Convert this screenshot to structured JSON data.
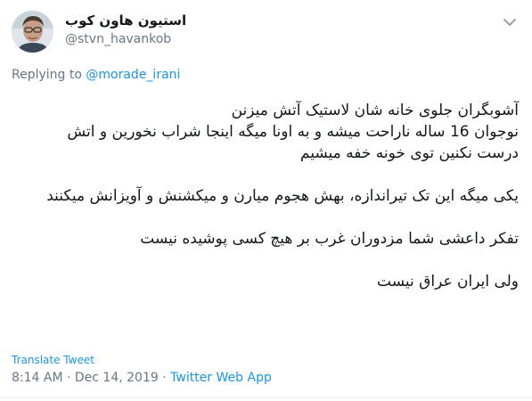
{
  "author": {
    "display_name": "استیون هاون کوب",
    "handle": "@stvn_havankob"
  },
  "reply": {
    "prefix": "Replying to",
    "to_handle": "@morade_irani"
  },
  "tweet": {
    "lines": [
      "آشوبگران جلوی خانه شان لاستیک آتش میزنن",
      "نوجوان 16 ساله ناراحت میشه و به اونا میگه اینجا شراب نخورین و اتش",
      "درست نکنین توی خونه خفه میشیم",
      "یکی میگه این تک تیراندازه، بهش هجوم میارن و میکشنش و آویزانش میکنند",
      "تفکر داعشی شما مزدوران غرب بر هیچ کسی پوشیده نیست",
      "ولی ایران عراق نیست"
    ]
  },
  "translate_label": "Translate Tweet",
  "timestamp": "8:14 AM · Dec 14, 2019",
  "separator": " · ",
  "source": "Twitter Web App",
  "colors": {
    "link": "#1b95e0",
    "muted": "#657786",
    "text": "#14171a"
  },
  "icons": {
    "menu": "chevron-down-icon"
  }
}
